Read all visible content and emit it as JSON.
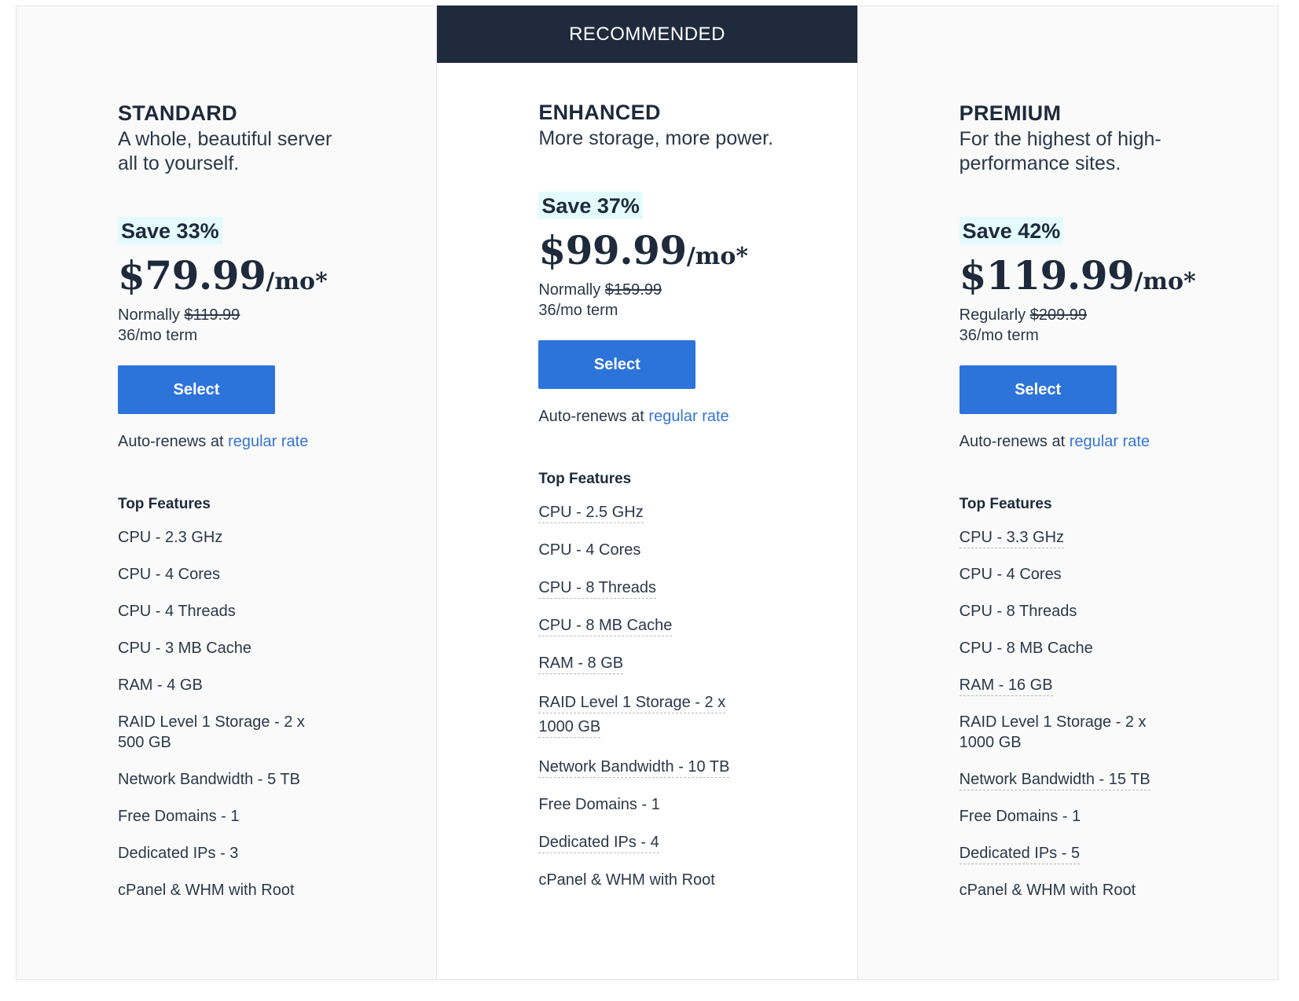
{
  "recommended_label": "RECOMMENDED",
  "colors": {
    "banner_bg": "#1f2b3d",
    "select_button": "#2d74da",
    "save_badge_bg": "#e3fbfd",
    "link": "#3575d3"
  },
  "features_title": "Top Features",
  "auto_renew_prefix": "Auto-renews at ",
  "auto_renew_link": "regular rate",
  "plans": [
    {
      "name": "STANDARD",
      "tagline": "A whole, beautiful server all to yourself.",
      "save": "Save 33%",
      "price": "$79.99",
      "per": "/mo*",
      "normal_label": "Normally ",
      "normal_price": "$119.99",
      "term": "36/mo term",
      "select_label": "Select",
      "recommended": false,
      "features": [
        {
          "text": "CPU - 2.3 GHz",
          "tooltip": false
        },
        {
          "text": "CPU - 4 Cores",
          "tooltip": false
        },
        {
          "text": "CPU - 4 Threads",
          "tooltip": false
        },
        {
          "text": "CPU - 3 MB Cache",
          "tooltip": false
        },
        {
          "text": "RAM - 4 GB",
          "tooltip": false
        },
        {
          "text": "RAID Level 1 Storage - 2 x 500 GB",
          "tooltip": false
        },
        {
          "text": "Network Bandwidth - 5 TB",
          "tooltip": false
        },
        {
          "text": "Free Domains - 1",
          "tooltip": false
        },
        {
          "text": "Dedicated IPs - 3",
          "tooltip": false
        },
        {
          "text": "cPanel & WHM with Root",
          "tooltip": false
        }
      ]
    },
    {
      "name": "ENHANCED",
      "tagline": "More storage, more power.",
      "save": "Save 37%",
      "price": "$99.99",
      "per": "/mo*",
      "normal_label": "Normally ",
      "normal_price": "$159.99",
      "term": "36/mo term",
      "select_label": "Select",
      "recommended": true,
      "features": [
        {
          "text": "CPU - 2.5 GHz",
          "tooltip": true
        },
        {
          "text": "CPU - 4 Cores",
          "tooltip": false
        },
        {
          "text": "CPU - 8 Threads",
          "tooltip": true
        },
        {
          "text": "CPU - 8 MB Cache",
          "tooltip": true
        },
        {
          "text": "RAM - 8 GB",
          "tooltip": true
        },
        {
          "text": "RAID Level 1 Storage - 2 x 1000 GB",
          "tooltip": true
        },
        {
          "text": "Network Bandwidth - 10 TB",
          "tooltip": true
        },
        {
          "text": "Free Domains - 1",
          "tooltip": false
        },
        {
          "text": "Dedicated IPs - 4",
          "tooltip": true
        },
        {
          "text": "cPanel & WHM with Root",
          "tooltip": false
        }
      ]
    },
    {
      "name": "PREMIUM",
      "tagline": "For the highest of high-performance sites.",
      "save": "Save 42%",
      "price": "$119.99",
      "per": "/mo*",
      "normal_label": "Regularly ",
      "normal_price": "$209.99",
      "term": "36/mo term",
      "select_label": "Select",
      "recommended": false,
      "features": [
        {
          "text": "CPU - 3.3 GHz",
          "tooltip": true
        },
        {
          "text": "CPU - 4 Cores",
          "tooltip": false
        },
        {
          "text": "CPU - 8 Threads",
          "tooltip": false
        },
        {
          "text": "CPU - 8 MB Cache",
          "tooltip": false
        },
        {
          "text": "RAM - 16 GB",
          "tooltip": true
        },
        {
          "text": "RAID Level 1 Storage - 2 x 1000 GB",
          "tooltip": false
        },
        {
          "text": "Network Bandwidth - 15 TB",
          "tooltip": true
        },
        {
          "text": "Free Domains - 1",
          "tooltip": false
        },
        {
          "text": "Dedicated IPs - 5",
          "tooltip": true
        },
        {
          "text": "cPanel & WHM with Root",
          "tooltip": false
        }
      ]
    }
  ]
}
